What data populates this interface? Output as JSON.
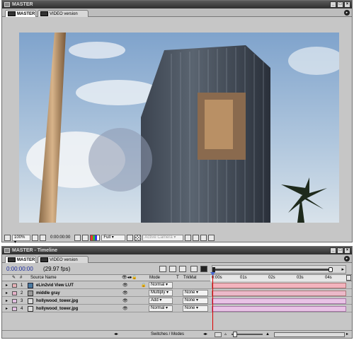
{
  "window": {
    "title": "MASTER"
  },
  "comp_panel": {
    "tabs": [
      {
        "label": "MASTER"
      },
      {
        "label": "VIDEO version"
      }
    ],
    "toolbar": {
      "zoom": "100%",
      "timecode": "0:00:00:00",
      "resolution": "Full",
      "camera": "Active Camera"
    }
  },
  "timeline": {
    "title": "MASTER - Timeline",
    "tabs": [
      {
        "label": "MASTER"
      },
      {
        "label": "VIDEO version"
      }
    ],
    "timecode": "0:00:00:00",
    "fps": "(29.97 fps)",
    "columns": {
      "num": "#",
      "source_name": "Source Name",
      "mode": "Mode",
      "t": "T",
      "trkmat": "TrkMat"
    },
    "ruler": [
      "0:00s",
      "01s",
      "02s",
      "03s",
      "04s"
    ],
    "layers": [
      {
        "num": "1",
        "name": "eLin2vid View LUT",
        "mode": "Normal",
        "trkmat": "",
        "label_color": "#e9b1b7",
        "bar_color": "#f3b3bd"
      },
      {
        "num": "2",
        "name": "middle gray",
        "mode": "Multiply",
        "trkmat": "None",
        "label_color": "#e6b2c8",
        "bar_color": "#ecb9c9"
      },
      {
        "num": "3",
        "name": "hollywood_tower.jpg",
        "mode": "Add",
        "trkmat": "None",
        "label_color": "#e1bfe1",
        "bar_color": "#e9c3e6"
      },
      {
        "num": "4",
        "name": "hollywood_tower.jpg",
        "mode": "Normal",
        "trkmat": "None",
        "label_color": "#e1bfe1",
        "bar_color": "#e9c3e6"
      }
    ],
    "footer": {
      "switches_label": "Switches / Modes"
    }
  }
}
